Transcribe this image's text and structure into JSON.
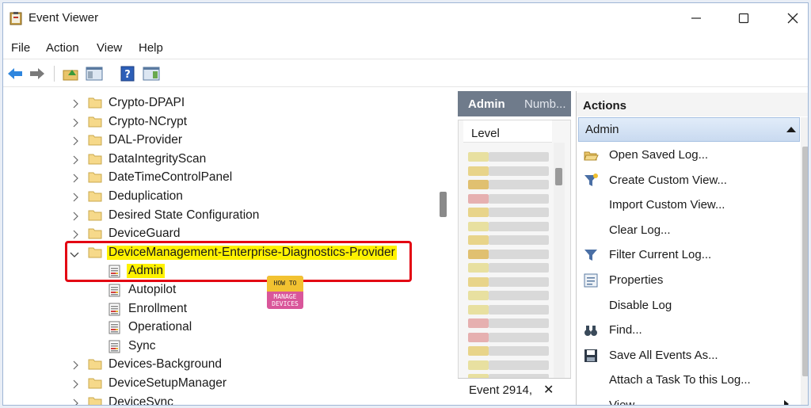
{
  "window": {
    "title": "Event Viewer",
    "controls": {
      "minimize": "─",
      "maximize": "☐",
      "close": "✕"
    }
  },
  "menu": [
    "File",
    "Action",
    "View",
    "Help"
  ],
  "toolbar": [
    "back-arrow-icon",
    "forward-arrow-icon",
    "up-folder-icon",
    "show-hide-console-tree-icon",
    "help-icon",
    "show-hide-action-pane-icon"
  ],
  "tree": {
    "folders_before": [
      "Crypto-DPAPI",
      "Crypto-NCrypt",
      "DAL-Provider",
      "DataIntegrityScan",
      "DateTimeControlPanel",
      "Deduplication",
      "Desired State Configuration",
      "DeviceGuard"
    ],
    "expanded_folder": "DeviceManagement-Enterprise-Diagnostics-Provider",
    "children": [
      "Admin",
      "Autopilot",
      "Enrollment",
      "Operational",
      "Sync"
    ],
    "selected_child": "Admin",
    "folders_after": [
      "Devices-Background",
      "DeviceSetupManager",
      "DeviceSync"
    ]
  },
  "logo": {
    "top": "HOW TO",
    "bottom_1": "MANAGE",
    "bottom_2": "DEVICES"
  },
  "middle": {
    "header_tab_1": "Admin",
    "header_tab_2": "Numb...",
    "column_header": "Level",
    "row_level_colors": [
      "#e8e0a0",
      "#e8d48a",
      "#e0c070",
      "#e6b0b0",
      "#e8d48a",
      "#e8e0a0",
      "#e8d48a",
      "#e0c070",
      "#e8e0a0",
      "#e8d48a",
      "#e8e0a0",
      "#e8e0a0",
      "#e6b0b0",
      "#e6b0b0",
      "#e8d48a",
      "#e8e0a0",
      "#e8e0a0",
      "#e8d48a"
    ],
    "footer_text": "Event 2914,",
    "footer_close": "✕"
  },
  "actions": {
    "header": "Actions",
    "section": "Admin",
    "items": [
      {
        "label": "Open Saved Log...",
        "icon": "open-folder-icon"
      },
      {
        "label": "Create Custom View...",
        "icon": "filter-star-icon"
      },
      {
        "label": "Import Custom View...",
        "icon": ""
      },
      {
        "label": "Clear Log...",
        "icon": ""
      },
      {
        "label": "Filter Current Log...",
        "icon": "filter-icon"
      },
      {
        "label": "Properties",
        "icon": "properties-icon"
      },
      {
        "label": "Disable Log",
        "icon": ""
      },
      {
        "label": "Find...",
        "icon": "binoculars-icon"
      },
      {
        "label": "Save All Events As...",
        "icon": "save-icon"
      },
      {
        "label": "Attach a Task To this Log...",
        "icon": ""
      },
      {
        "label": "View",
        "icon": ""
      }
    ]
  }
}
